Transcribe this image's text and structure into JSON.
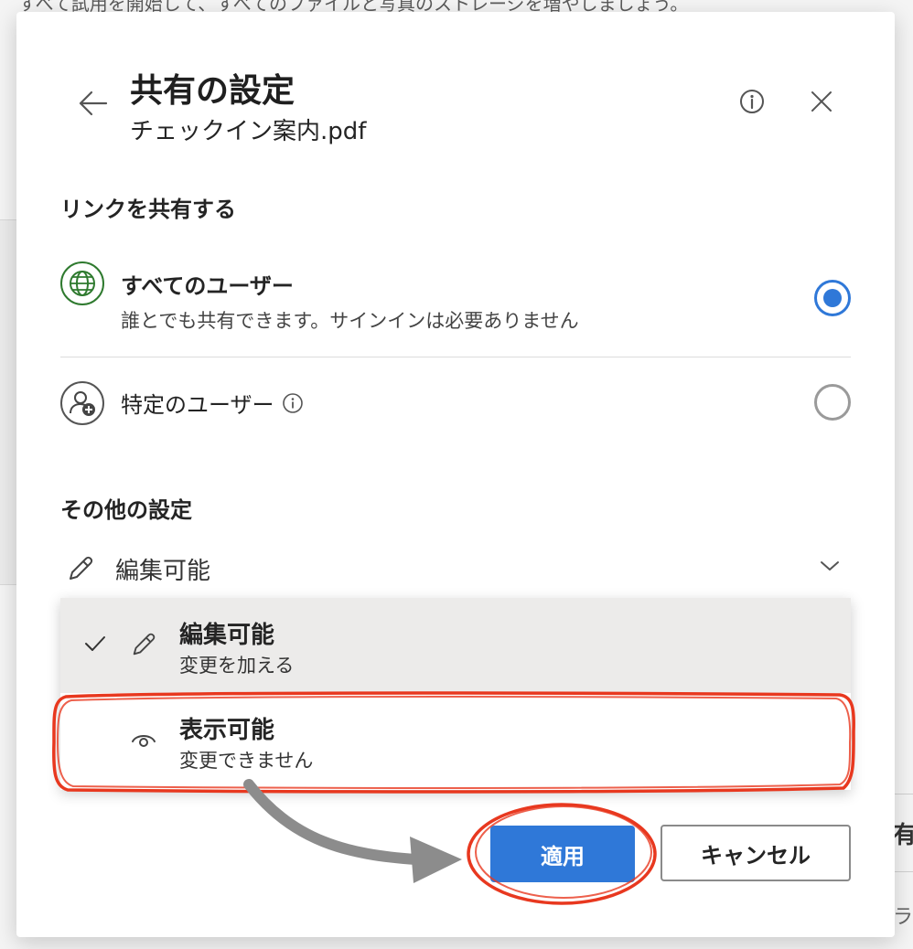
{
  "background": {
    "top_text": "すべて試用を開始して、すべてのファイルと写真のストレージを増やしましょう。",
    "right_text_1": "有",
    "right_text_2": "ラ"
  },
  "dialog": {
    "title": "共有の設定",
    "filename": "チェックイン案内.pdf",
    "back_icon": "arrow-left-icon",
    "info_icon": "info-icon",
    "close_icon": "close-icon"
  },
  "link_section": {
    "heading": "リンクを共有する",
    "options": [
      {
        "label": "すべてのユーザー",
        "description": "誰とでも共有できます。サインインは必要ありません",
        "icon": "globe-icon",
        "selected": true
      },
      {
        "label": "特定のユーザー",
        "icon": "person-add-icon",
        "selected": false
      }
    ]
  },
  "other_settings": {
    "heading": "その他の設定",
    "permission_value": "編集可能",
    "dropdown": [
      {
        "title": "編集可能",
        "subtitle": "変更を加える",
        "icon": "pencil-icon",
        "checked": true
      },
      {
        "title": "表示可能",
        "subtitle": "変更できません",
        "icon": "eye-icon",
        "checked": false
      }
    ]
  },
  "buttons": {
    "apply": "適用",
    "cancel": "キャンセル"
  },
  "colors": {
    "accent": "#2f78d8",
    "globe_green": "#2f7a2f",
    "annotation_red": "#e8381f",
    "annotation_arrow": "#8c8c8c"
  }
}
